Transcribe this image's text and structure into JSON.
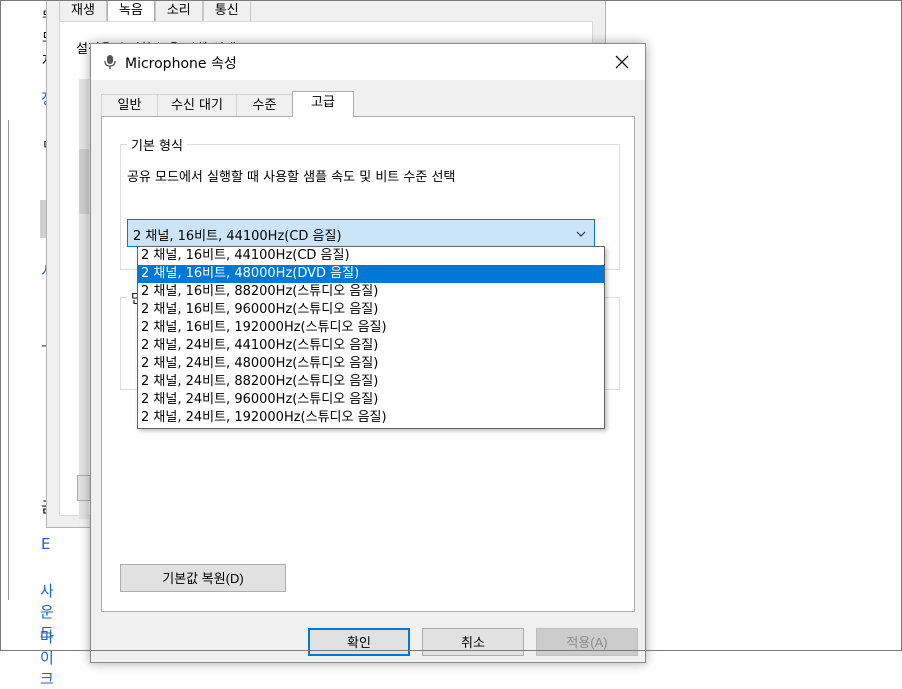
{
  "background_page": {
    "fragments": [
      "뒤",
      "모",
      "저",
      "정",
      "ㅁ",
      "시",
      "ㅡ",
      "금",
      "E"
    ],
    "links": [
      "사운드",
      "마이크"
    ]
  },
  "background_dialog": {
    "tabs": [
      "재생",
      "녹음",
      "소리",
      "통신"
    ],
    "active_tab": "녹음",
    "partial_text": "설정을 수정할 녹음 장치 선택"
  },
  "dialog": {
    "title": "Microphone 속성",
    "tabs": [
      {
        "label": "일반"
      },
      {
        "label": "수신 대기"
      },
      {
        "label": "수준"
      },
      {
        "label": "고급"
      }
    ],
    "active_tab": "고급",
    "default_format": {
      "group_label": "기본 형식",
      "description": "공유 모드에서 실행할 때 사용할 샘플 속도 및 비트 수준 선택",
      "selected_value": "2 채널, 16비트, 44100Hz(CD 음질)"
    },
    "second_group_fragment": "단",
    "dropdown_options": [
      "2 채널, 16비트, 44100Hz(CD 음질)",
      "2 채널, 16비트, 48000Hz(DVD 음질)",
      "2 채널, 16비트, 88200Hz(스튜디오 음질)",
      "2 채널, 16비트, 96000Hz(스튜디오 음질)",
      "2 채널, 16비트, 192000Hz(스튜디오 음질)",
      "2 채널, 24비트, 44100Hz(스튜디오 음질)",
      "2 채널, 24비트, 48000Hz(스튜디오 음질)",
      "2 채널, 24비트, 88200Hz(스튜디오 음질)",
      "2 채널, 24비트, 96000Hz(스튜디오 음질)",
      "2 채널, 24비트, 192000Hz(스튜디오 음질)"
    ],
    "highlighted_option": "2 채널, 16비트, 48000Hz(DVD 음질)",
    "restore_button": "기본값 복원(D)",
    "buttons": {
      "ok": "확인",
      "cancel": "취소",
      "apply": "적용(A)"
    }
  },
  "colors": {
    "accent": "#0078d7",
    "selection_bg": "#cce4f7",
    "link": "#1a64c8",
    "dialog_bg": "#f0f0f0"
  }
}
